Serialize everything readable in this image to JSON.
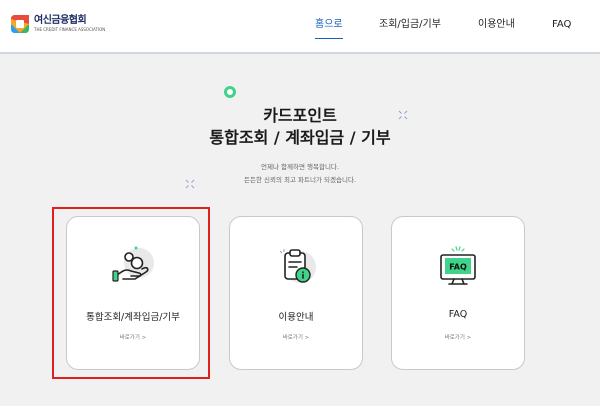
{
  "header": {
    "logo": {
      "title": "여신금융협회",
      "subtitle": "THE CREDIT FINANCE ASSOCIATION"
    },
    "nav": [
      {
        "label": "홈으로",
        "active": true
      },
      {
        "label": "조회/입금/기부",
        "active": false
      },
      {
        "label": "이용안내",
        "active": false
      },
      {
        "label": "FAQ",
        "active": false
      }
    ]
  },
  "hero": {
    "title_line1": "카드포인트",
    "title_line2": "통합조회 / 계좌입금 / 기부",
    "desc_line1": "언제나 함께하면 행복합니다.",
    "desc_line2": "든든한 신뢰의 최고 파트너가 되겠습니다."
  },
  "cards": [
    {
      "title": "통합조회/계좌입금/기부",
      "link": "바로가기 >",
      "icon": "hand-coins-icon"
    },
    {
      "title": "이용안내",
      "link": "바로가기 >",
      "icon": "clipboard-info-icon"
    },
    {
      "title": "FAQ",
      "link": "바로가기 >",
      "icon": "faq-screen-icon"
    }
  ],
  "colors": {
    "accent": "#1560bd",
    "highlight": "#e0201e",
    "green": "#3fd48a"
  }
}
